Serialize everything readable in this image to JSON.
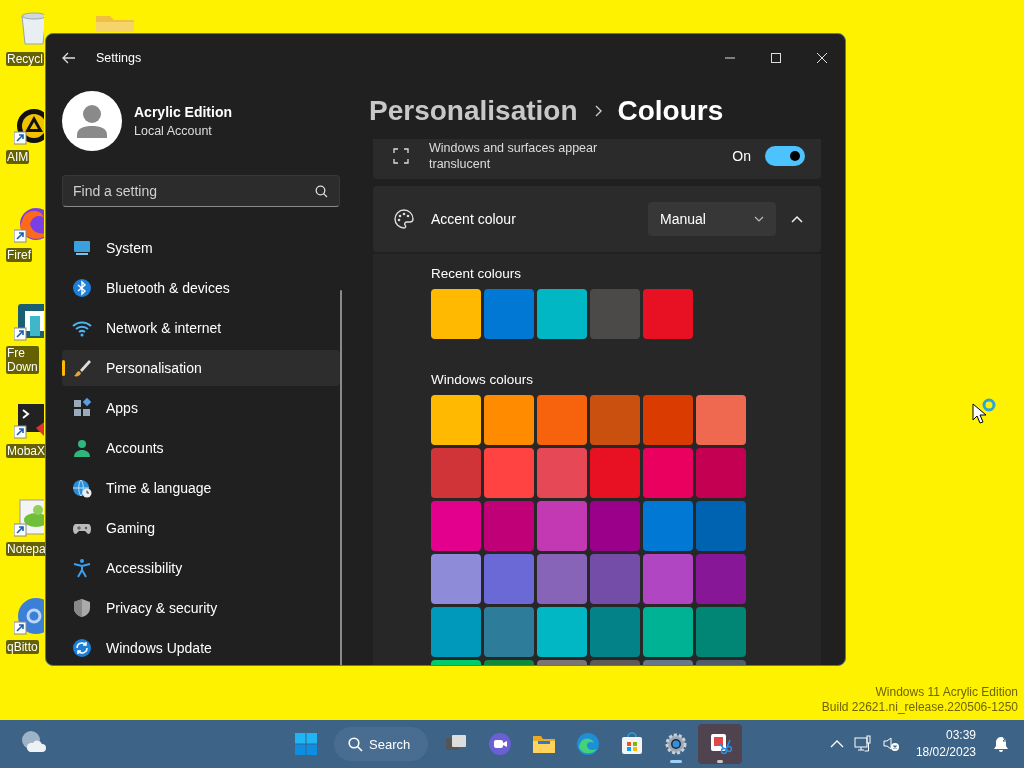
{
  "desktop": {
    "icons": [
      {
        "lines": [
          "Recycl"
        ]
      },
      {
        "lines": [
          "AIM"
        ]
      },
      {
        "lines": [
          "Firef"
        ]
      },
      {
        "lines": [
          "Fre",
          "Down"
        ]
      },
      {
        "lines": [
          "MobaX"
        ]
      },
      {
        "lines": [
          "Notepa"
        ]
      },
      {
        "lines": [
          "qBitto"
        ]
      }
    ],
    "watermark": [
      "Windows 11 Acrylic Edition",
      "Build 22621.ni_release.220506-1250"
    ]
  },
  "window": {
    "title": "Settings",
    "account": {
      "name": "Acrylic Edition",
      "type": "Local Account"
    },
    "search": {
      "placeholder": "Find a setting"
    },
    "sidebar": {
      "items": [
        {
          "label": "System",
          "selected": false
        },
        {
          "label": "Bluetooth & devices",
          "selected": false
        },
        {
          "label": "Network & internet",
          "selected": false
        },
        {
          "label": "Personalisation",
          "selected": true
        },
        {
          "label": "Apps",
          "selected": false
        },
        {
          "label": "Accounts",
          "selected": false
        },
        {
          "label": "Time & language",
          "selected": false
        },
        {
          "label": "Gaming",
          "selected": false
        },
        {
          "label": "Accessibility",
          "selected": false
        },
        {
          "label": "Privacy & security",
          "selected": false
        },
        {
          "label": "Windows Update",
          "selected": false
        }
      ]
    },
    "breadcrumb": [
      "Personalisation",
      "Colours"
    ],
    "transparency": {
      "description": "Windows and surfaces appear translucent",
      "state_label": "On",
      "on": true
    },
    "accent": {
      "label": "Accent colour",
      "dropdown": "Manual",
      "expanded": true,
      "recent_title": "Recent colours",
      "recent": [
        {
          "color": "#ffb900"
        },
        {
          "color": "#0078d4"
        },
        {
          "color": "#00b7c3"
        },
        {
          "color": "#4c4a48"
        },
        {
          "color": "#e81123"
        }
      ],
      "windows_title": "Windows colours",
      "windows": [
        {
          "color": "#ffb900"
        },
        {
          "color": "#ff8c00"
        },
        {
          "color": "#f7630c"
        },
        {
          "color": "#ca5010"
        },
        {
          "color": "#da3b01"
        },
        {
          "color": "#ef6950"
        },
        {
          "color": "#d13438"
        },
        {
          "color": "#ff4343"
        },
        {
          "color": "#e74856"
        },
        {
          "color": "#e81123"
        },
        {
          "color": "#ea005e"
        },
        {
          "color": "#c30052"
        },
        {
          "color": "#e3008c"
        },
        {
          "color": "#bf0077"
        },
        {
          "color": "#c239b3"
        },
        {
          "color": "#9a0089"
        },
        {
          "color": "#0078d4"
        },
        {
          "color": "#0063b1"
        },
        {
          "color": "#8e8cd8"
        },
        {
          "color": "#6b69d6"
        },
        {
          "color": "#8764b8"
        },
        {
          "color": "#744da9"
        },
        {
          "color": "#b146c2"
        },
        {
          "color": "#881798"
        },
        {
          "color": "#0099bc"
        },
        {
          "color": "#2d7d9a"
        },
        {
          "color": "#00b7c3"
        },
        {
          "color": "#038387"
        },
        {
          "color": "#00b294"
        },
        {
          "color": "#018574"
        },
        {
          "color": "#00cc6a"
        },
        {
          "color": "#10893e"
        },
        {
          "color": "#7a7574"
        },
        {
          "color": "#5d5a58"
        },
        {
          "color": "#68768a"
        },
        {
          "color": "#515c6b"
        }
      ]
    }
  },
  "taskbar": {
    "search": "Search",
    "apps": [
      {
        "kind": "task-view",
        "running": false,
        "selected": false
      },
      {
        "kind": "chat",
        "running": false,
        "selected": false
      },
      {
        "kind": "files",
        "running": false,
        "selected": false
      },
      {
        "kind": "browser",
        "running": false,
        "selected": false
      },
      {
        "kind": "store",
        "running": false,
        "selected": false
      },
      {
        "kind": "settings",
        "running": true,
        "selected": false
      },
      {
        "kind": "snipping",
        "running": true,
        "selected": true
      }
    ],
    "clock": {
      "time": "03:39",
      "date": "18/02/2023"
    }
  }
}
